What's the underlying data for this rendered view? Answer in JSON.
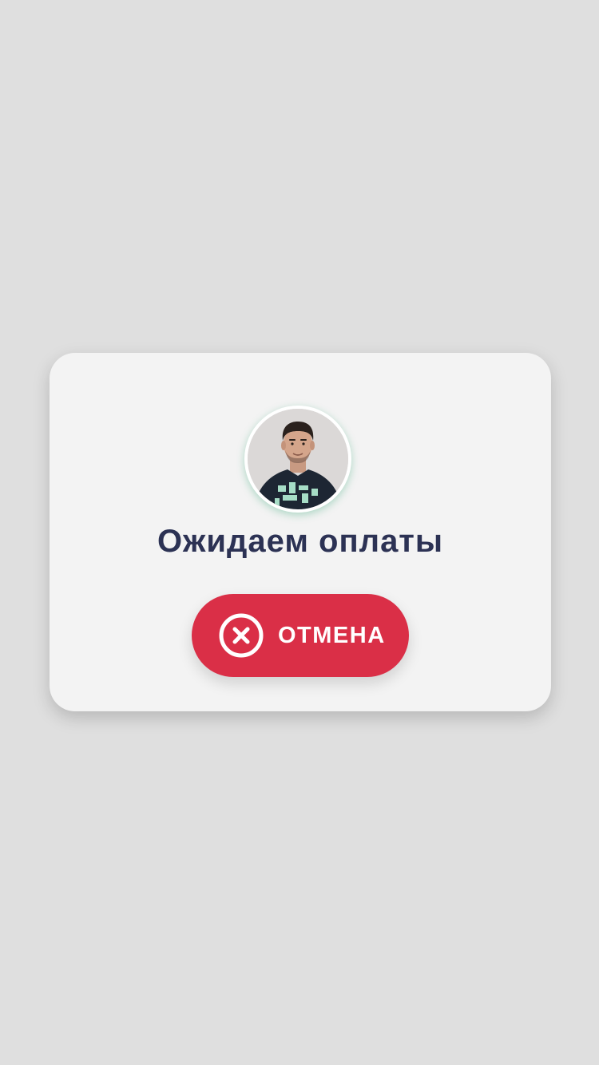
{
  "dialog": {
    "title": "Ожидаем оплаты",
    "cancel_label": "ОТМЕНА",
    "avatar_icon": "user-photo",
    "cancel_icon": "close-circle-icon"
  },
  "colors": {
    "background": "#dfdfdf",
    "card": "#f3f3f3",
    "title": "#2c3254",
    "cancel_button": "#da2f47",
    "cancel_text": "#ffffff",
    "avatar_glow": "#28a06e"
  }
}
